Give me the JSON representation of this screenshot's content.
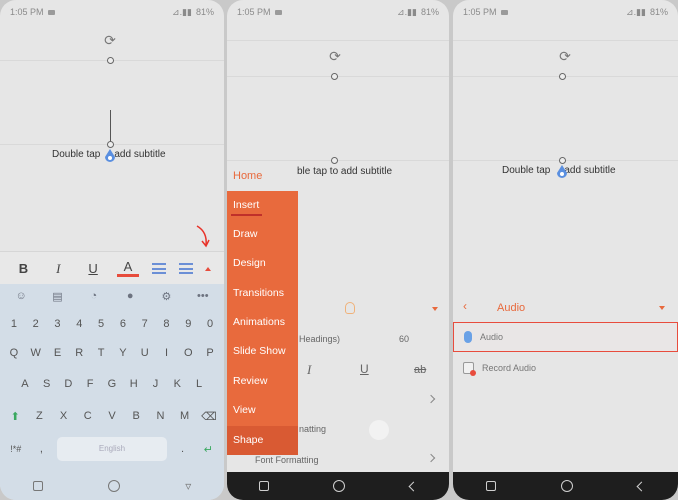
{
  "status": {
    "time": "1:05 PM",
    "battery": "81%",
    "signal": "⊿.▮▮"
  },
  "slide": {
    "subtitle_placeholder": "Double tap to add subtitle",
    "subtitle_partial": "ble tap to add subtitle",
    "subtitle_left": "Double tap",
    "subtitle_right": "add subtitle"
  },
  "format_toolbar": {
    "bold": "B",
    "italic": "I",
    "underline": "U",
    "font_color": "A"
  },
  "keyboard": {
    "tools": [
      "☺",
      "▤",
      "◔",
      "●",
      "⚙",
      "•••"
    ],
    "numbers": [
      "1",
      "2",
      "3",
      "4",
      "5",
      "6",
      "7",
      "8",
      "9",
      "0"
    ],
    "row1": [
      "Q",
      "W",
      "E",
      "R",
      "T",
      "Y",
      "U",
      "I",
      "O",
      "P"
    ],
    "row2": [
      "A",
      "S",
      "D",
      "F",
      "G",
      "H",
      "J",
      "K",
      "L"
    ],
    "row3": [
      "Z",
      "X",
      "C",
      "V",
      "B",
      "N",
      "M"
    ],
    "symbols": "!*#",
    "comma": ",",
    "space": "English",
    "period": "."
  },
  "menu": {
    "home": "Home",
    "items": [
      "Insert",
      "Draw",
      "Design",
      "Transitions",
      "Animations",
      "Slide Show",
      "Review",
      "View",
      "Shape"
    ]
  },
  "panel2_bg": {
    "headings": "Headings)",
    "size": "60",
    "italic": "I",
    "underline": "U",
    "strike": "ab",
    "formatting": "natting",
    "font_formatting": "Font Formatting"
  },
  "audio_panel": {
    "title": "Audio",
    "items": [
      "Audio",
      "Record Audio"
    ]
  },
  "colors": {
    "accent": "#e86a3d",
    "selection_border": "#e84c3d",
    "link_blue": "#6aa1e6"
  }
}
